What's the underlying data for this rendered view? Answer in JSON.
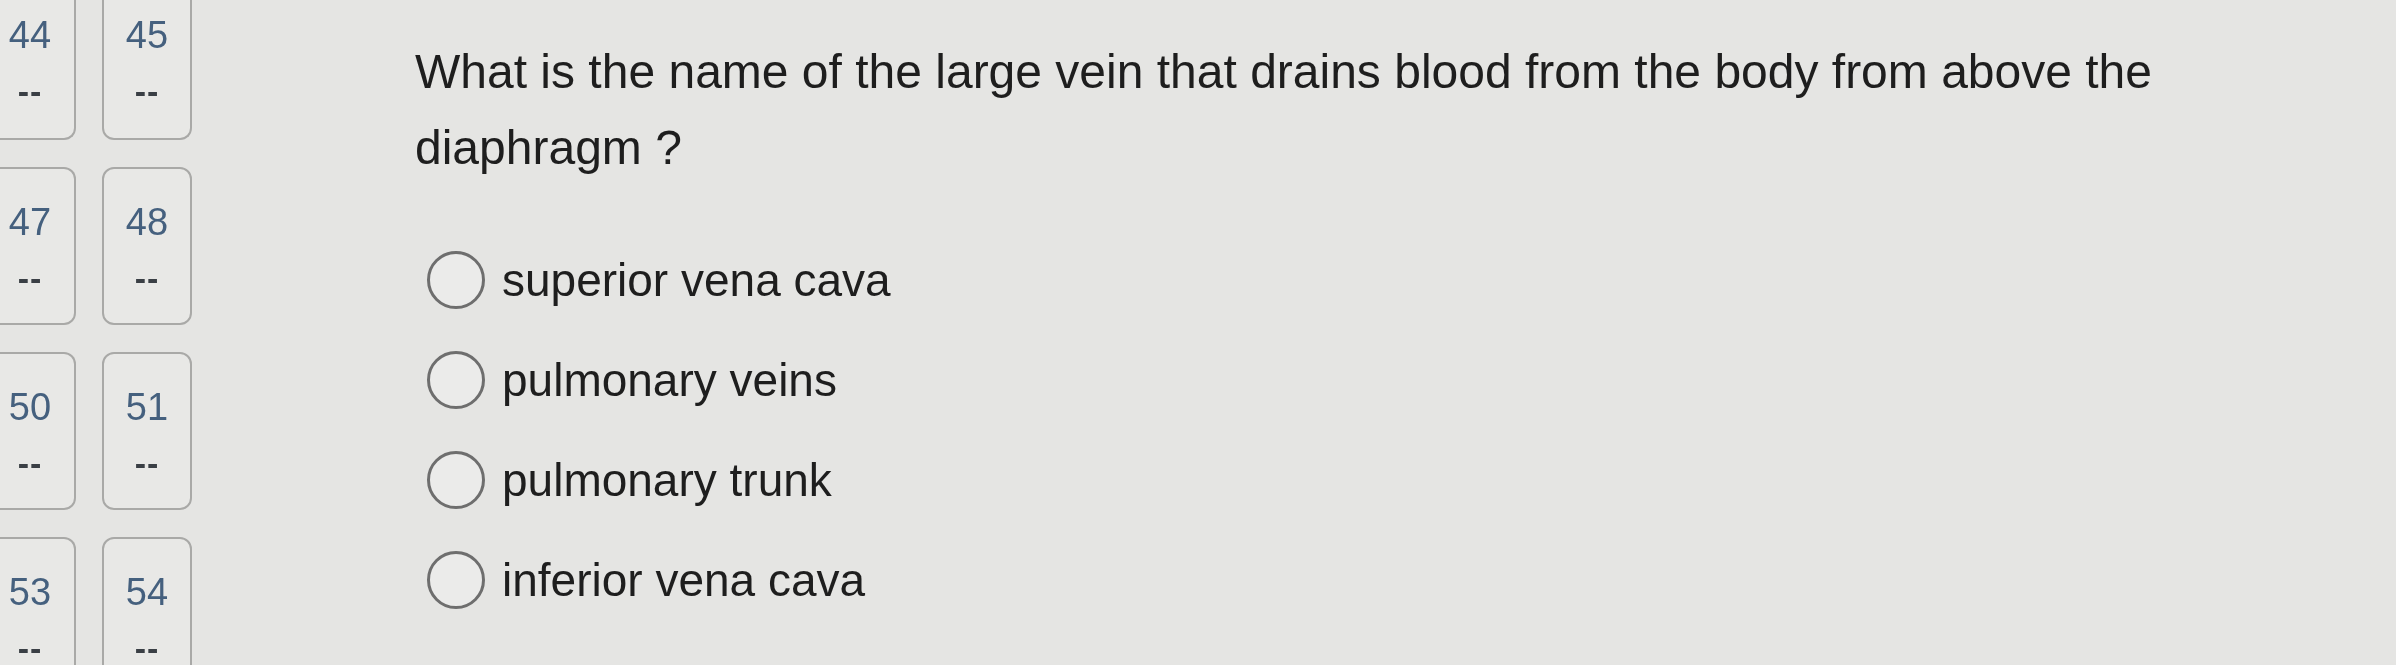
{
  "question_nav": [
    {
      "number": "44",
      "answer": "--"
    },
    {
      "number": "45",
      "answer": "--"
    },
    {
      "number": "47",
      "answer": "--"
    },
    {
      "number": "48",
      "answer": "--"
    },
    {
      "number": "50",
      "answer": "--"
    },
    {
      "number": "51",
      "answer": "--"
    },
    {
      "number": "53",
      "answer": "--"
    },
    {
      "number": "54",
      "answer": "--"
    }
  ],
  "question": {
    "text": "What is the name of the large vein that drains blood from the body from above the diaphragm ?",
    "options": [
      {
        "label": "superior vena cava",
        "selected": false
      },
      {
        "label": "pulmonary veins",
        "selected": false
      },
      {
        "label": "pulmonary trunk",
        "selected": false
      },
      {
        "label": "inferior vena cava",
        "selected": false
      }
    ]
  }
}
